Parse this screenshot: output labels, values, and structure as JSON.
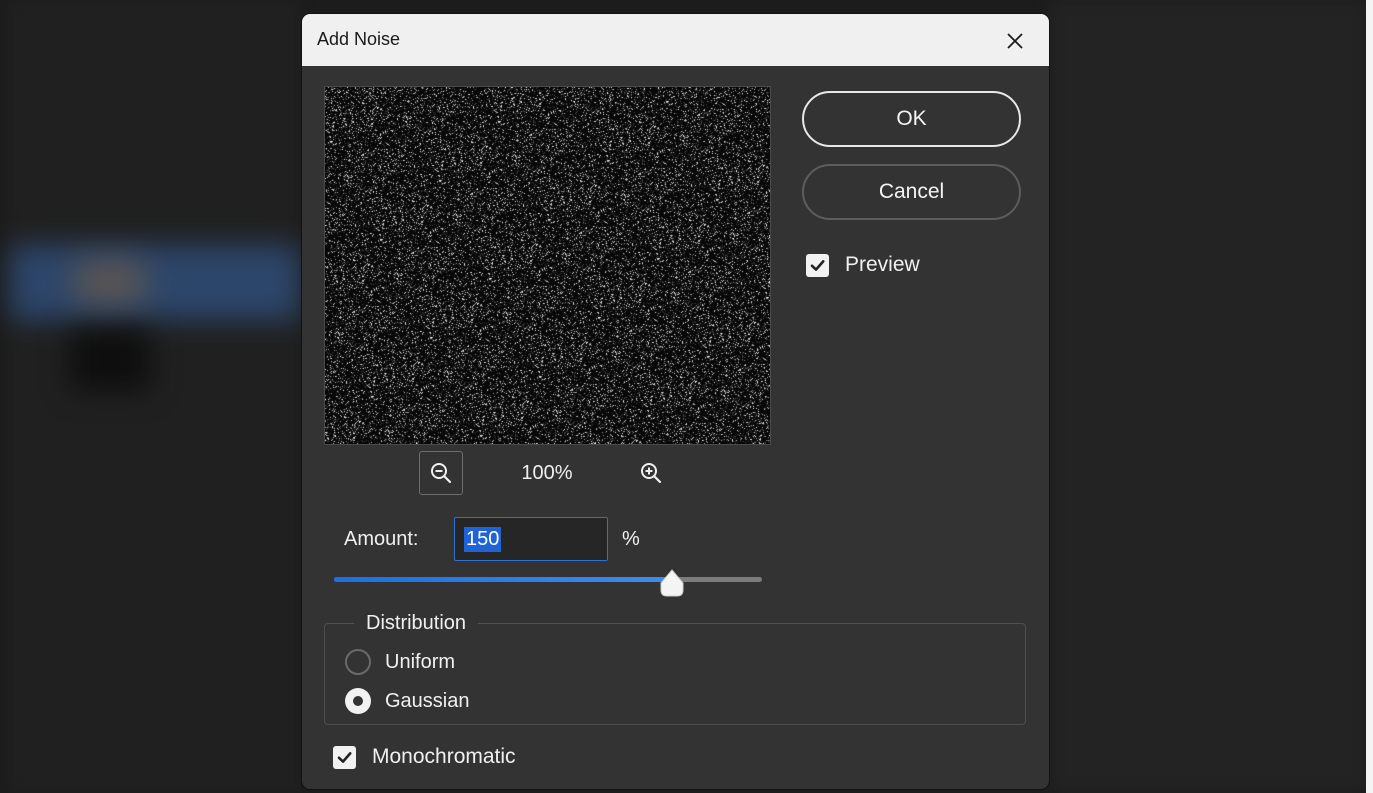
{
  "dialog": {
    "title": "Add Noise",
    "ok_label": "OK",
    "cancel_label": "Cancel",
    "preview_label": "Preview",
    "preview_checked": true
  },
  "zoom": {
    "level": "100%"
  },
  "amount": {
    "label": "Amount:",
    "value": "150",
    "unit": "%",
    "slider_fraction": 0.79
  },
  "distribution": {
    "label": "Distribution",
    "options": [
      {
        "label": "Uniform",
        "selected": false
      },
      {
        "label": "Gaussian",
        "selected": true
      }
    ]
  },
  "monochromatic": {
    "label": "Monochromatic",
    "checked": true
  },
  "icons": {
    "close": "close-icon",
    "zoom_out": "zoom-out-icon",
    "zoom_in": "zoom-in-icon",
    "check": "checkmark-icon"
  },
  "colors": {
    "accent": "#1f63d6",
    "dialog_bg": "#333333",
    "titlebar_bg": "#f0f0f0"
  }
}
